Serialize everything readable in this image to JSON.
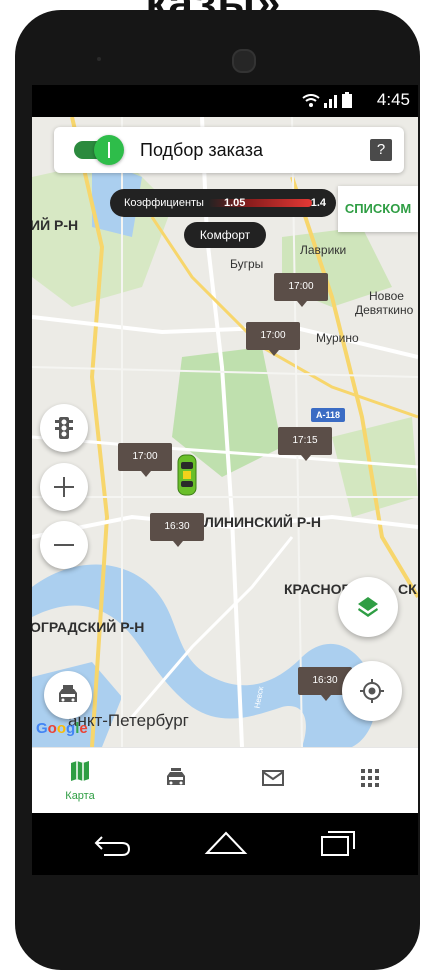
{
  "header_fragment": "казы»",
  "status": {
    "time": "4:45"
  },
  "order_picker": {
    "title": "Подбор заказа",
    "help": "?"
  },
  "coefficients": {
    "label": "Коэффициенты",
    "min": "1.05",
    "max": "1.4"
  },
  "list_button": "СПИСКОМ",
  "tariff": "Комфорт",
  "pins": [
    "17:00",
    "17:00",
    "17:15",
    "17:00",
    "16:30",
    "16:30"
  ],
  "map_labels": {
    "district_nw": "ИЙ Р-Н",
    "lavriki": "Лаврики",
    "bugry": "Бугры",
    "novoe_devyatkino_1": "Новое",
    "novoe_devyatkino_2": "Девяткино",
    "murino": "Мурино",
    "road": "А-118",
    "kalininsky": "ЛИНИНСКИЙ Р-Н",
    "krasnogvard": "КРАСНОГ",
    "krasnogvard_2": "СК",
    "admiralteysky": "ОГРАДСКИЙ Р-Н",
    "spb": "анкт-Петербург",
    "google": "Google",
    "road_small": "Невск"
  },
  "nav": {
    "map_label": "Карта"
  },
  "colors": {
    "accent": "#2f9e44",
    "pin": "#5b4e48",
    "water": "#abcfef",
    "park": "#bfe0ae"
  },
  "icons": [
    "traffic-light-icon",
    "plus-icon",
    "minus-icon",
    "taxi-icon",
    "layers-icon",
    "locate-icon",
    "map-icon",
    "car-icon",
    "mail-icon",
    "grid-icon",
    "back-icon",
    "home-icon",
    "recents-icon"
  ]
}
